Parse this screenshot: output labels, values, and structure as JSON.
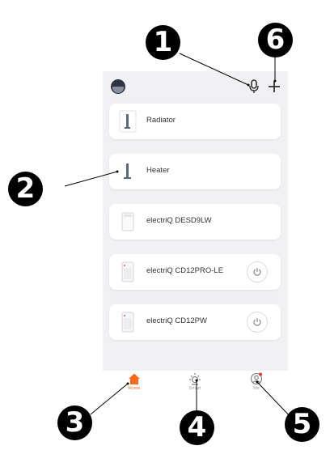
{
  "devices": [
    {
      "name": "Radiator",
      "icon": "radiator-icon",
      "power": false
    },
    {
      "name": "Heater",
      "icon": "heater-icon",
      "power": false
    },
    {
      "name": "electriQ DESD9LW",
      "icon": "dehumidifier-icon",
      "power": false
    },
    {
      "name": "electriQ CD12PRO-LE",
      "icon": "dehumidifier-icon",
      "power": true
    },
    {
      "name": "electriQ CD12PW",
      "icon": "dehumidifier-icon",
      "power": true
    }
  ],
  "tabs": [
    {
      "label": "Home",
      "icon": "home-icon",
      "active": true
    },
    {
      "label": "Smart",
      "icon": "sun-icon",
      "active": false
    },
    {
      "label": "Me",
      "icon": "user-icon",
      "active": false
    }
  ],
  "callouts": [
    "1",
    "2",
    "3",
    "4",
    "5",
    "6"
  ],
  "colors": {
    "accent": "#ff6a1f",
    "badge": "#000000",
    "background": "#f1f1f3"
  }
}
